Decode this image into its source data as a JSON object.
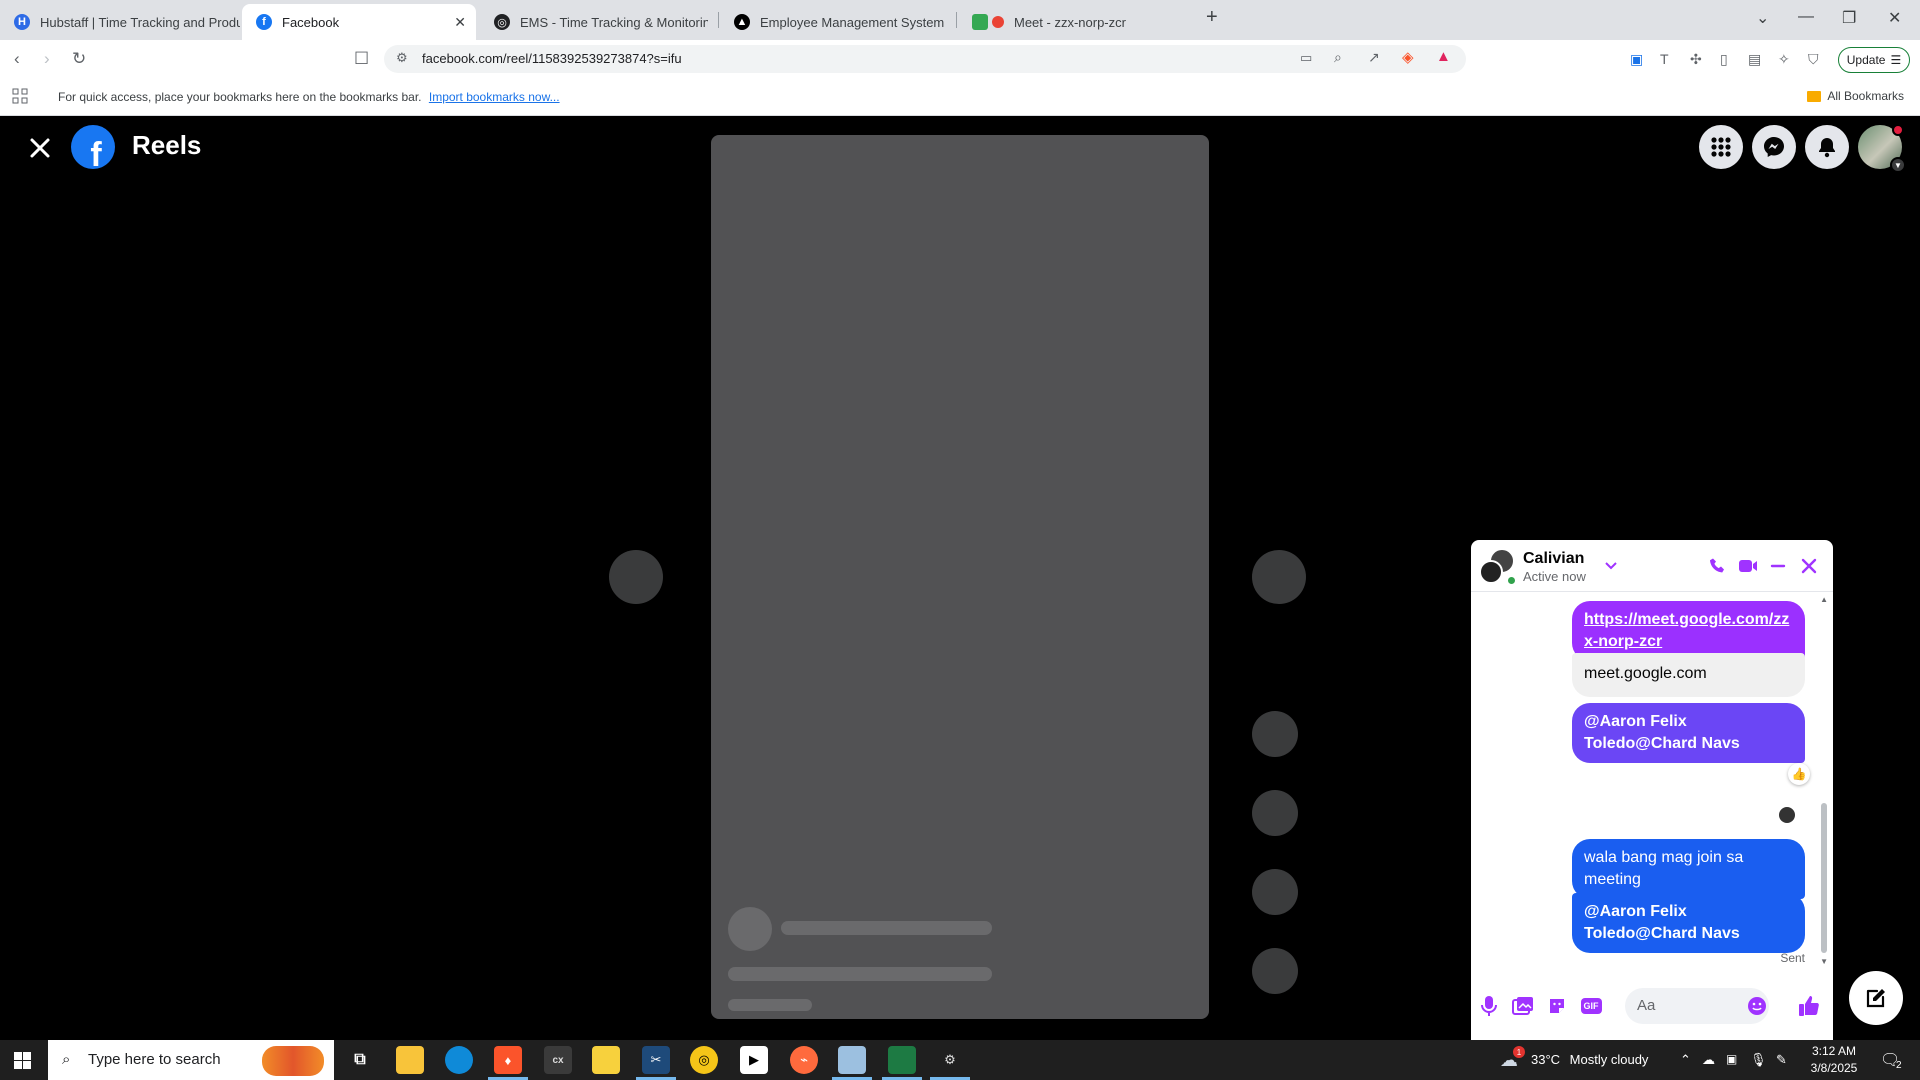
{
  "browser": {
    "tabs": [
      {
        "title": "Hubstaff | Time Tracking and Produ",
        "color": "#2e6be6",
        "glyph": "H"
      },
      {
        "title": "Facebook",
        "color": "#1877f2",
        "glyph": "f",
        "active": true
      },
      {
        "title": "EMS - Time Tracking & Monitoring",
        "color": "#202124",
        "glyph": "◎"
      },
      {
        "title": "Employee Management System",
        "color": "#000000",
        "glyph": "▲"
      },
      {
        "title": "Meet - zzx-norp-zcr",
        "color": "#ea4335",
        "glyph": "●"
      }
    ],
    "url": "facebook.com/reel/1158392539273874?s=ifu",
    "update_label": "Update",
    "bookmarks_message": "For quick access, place your bookmarks here on the bookmarks bar.",
    "import_link": "Import bookmarks now...",
    "all_bookmarks": "All Bookmarks"
  },
  "facebook": {
    "page_title": "Reels",
    "logo_glyph": "f",
    "brand_color": "#1877f2"
  },
  "chat": {
    "contact_name": "Calivian",
    "status": "Active now",
    "accent": "#a033ff",
    "messages": [
      {
        "type": "link",
        "text": "https://meet.google.com/zzx-norp-zcr"
      },
      {
        "type": "preview",
        "text": "meet.google.com"
      },
      {
        "type": "text",
        "text": "@Aaron Felix Toledo@Chard Navs",
        "reaction": "👍"
      },
      {
        "type": "text",
        "text": "wala bang mag join sa meeting"
      },
      {
        "type": "text",
        "text": "@Aaron Felix Toledo@Chard Navs"
      }
    ],
    "sent_label": "Sent",
    "input_placeholder": "Aa",
    "gif_label": "GIF"
  },
  "taskbar": {
    "search_placeholder": "Type here to search",
    "weather_temp": "33°C",
    "weather_text": "Mostly cloudy",
    "time": "3:12 AM",
    "date": "3/8/2025",
    "notification_count": "2",
    "weather_badge": "1"
  }
}
